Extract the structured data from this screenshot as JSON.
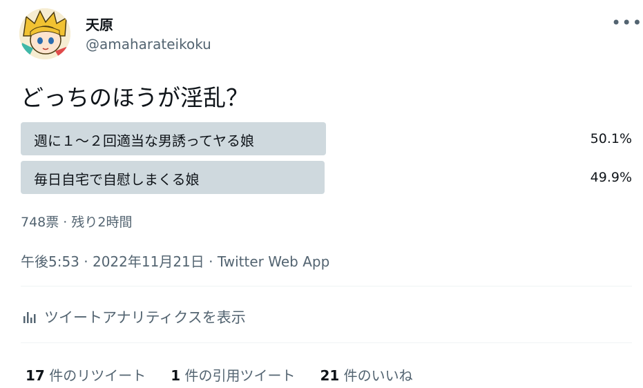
{
  "tweet": {
    "display_name": "天原",
    "handle": "@amaharateikoku",
    "more_icon": "more-horizontal-icon",
    "text": "どっちのほうが淫乱？"
  },
  "poll": {
    "options": [
      {
        "label": "週に１～２回適当な男誘ってヤる娘",
        "percent": "50.1%",
        "share": 0.501
      },
      {
        "label": "毎日自宅で自慰しまくる娘",
        "percent": "49.9%",
        "share": 0.499
      }
    ],
    "meta": "748票 · 残り2時間"
  },
  "timestamp": "午後5:53 · 2022年11月21日 · Twitter Web App",
  "analytics": {
    "icon": "bar-chart-icon",
    "label": "ツイートアナリティクスを表示"
  },
  "stats": {
    "retweets_count": "17",
    "retweets_label": " 件のリツイート",
    "quotes_count": "1",
    "quotes_label": " 件の引用ツイート",
    "likes_count": "21",
    "likes_label": " 件のいいね"
  },
  "colors": {
    "poll_fill": "#cfd9de",
    "secondary_text": "#536471",
    "primary_text": "#0f1419"
  }
}
